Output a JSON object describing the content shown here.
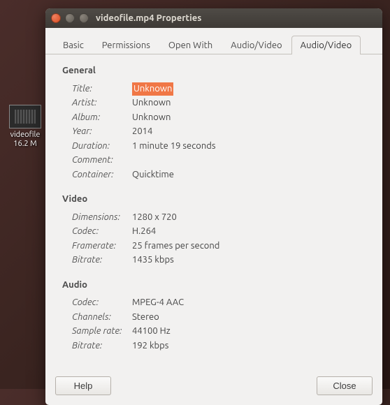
{
  "desktop_icon": {
    "filename": "videofile",
    "size": "16.2 M"
  },
  "window": {
    "title": "videofile.mp4 Properties"
  },
  "tabs": {
    "basic": "Basic",
    "permissions": "Permissions",
    "open_with": "Open With",
    "av1": "Audio/Video",
    "av2": "Audio/Video"
  },
  "labels": {
    "general": "General",
    "title": "Title:",
    "artist": "Artist:",
    "album": "Album:",
    "year": "Year:",
    "duration": "Duration:",
    "comment": "Comment:",
    "container": "Container:",
    "video": "Video",
    "dimensions": "Dimensions:",
    "codec": "Codec:",
    "framerate": "Framerate:",
    "bitrate": "Bitrate:",
    "audio": "Audio",
    "channels": "Channels:",
    "sample_rate": "Sample rate:"
  },
  "general": {
    "title": "Unknown",
    "artist": "Unknown",
    "album": "Unknown",
    "year": "2014",
    "duration": "1 minute 19 seconds",
    "comment": "",
    "container": "Quicktime"
  },
  "video": {
    "dimensions": "1280 x 720",
    "codec": "H.264",
    "framerate": "25 frames per second",
    "bitrate": "1435 kbps"
  },
  "audio": {
    "codec": "MPEG-4 AAC",
    "channels": "Stereo",
    "sample_rate": "44100 Hz",
    "bitrate": "192 kbps"
  },
  "footer": {
    "help": "Help",
    "close": "Close"
  }
}
